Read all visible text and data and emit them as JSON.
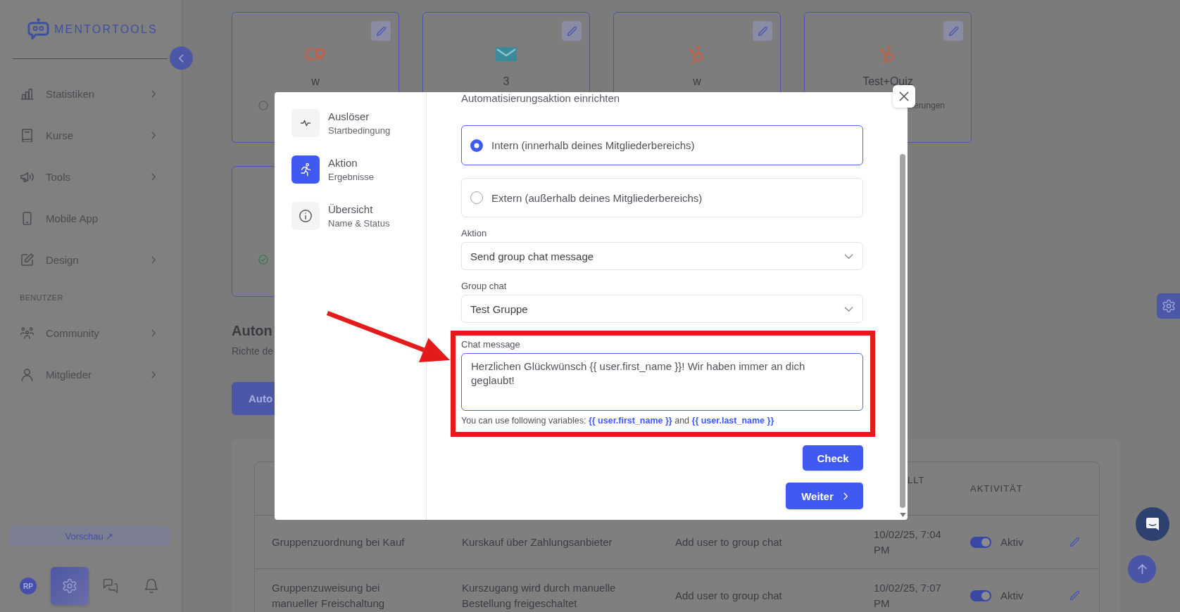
{
  "sidebar": {
    "logo": "MENTORTOOLS",
    "nav": [
      {
        "label": "Statistiken",
        "expandable": true
      },
      {
        "label": "Kurse",
        "expandable": true
      },
      {
        "label": "Tools",
        "expandable": true
      },
      {
        "label": "Mobile App",
        "expandable": false
      },
      {
        "label": "Design",
        "expandable": true
      }
    ],
    "users_section": {
      "heading": "BENUTZER",
      "nav": [
        {
          "label": "Community",
          "expandable": true
        },
        {
          "label": "Mitglieder",
          "expandable": true
        }
      ]
    },
    "preview_button": "Vorschau ↗",
    "footer": {
      "avatar": "RP",
      "buttons": [
        {
          "selected": true
        },
        {
          "selected": false
        },
        {
          "selected": false
        }
      ]
    }
  },
  "main": {
    "cards": [
      {
        "title": "w",
        "active": false
      },
      {
        "title": "3"
      },
      {
        "title": "w"
      },
      {
        "title": "Test+Quiz",
        "note": "ierungen"
      },
      {
        "active": true
      }
    ],
    "heading": "Auton",
    "subheading": "Richte de",
    "create_button": "Auto",
    "table": {
      "header": {
        "column_4": "LLT",
        "column_5": "AKTIVITÄT"
      },
      "rows": [
        {
          "column_1": "Gruppenzuordnung bei Kauf",
          "column_2": "Kurskauf über Zahlungsanbieter",
          "column_3": "Add user to group chat",
          "column_4": "10/02/25, 7:04 PM",
          "active": true,
          "activity": "Aktiv"
        },
        {
          "column_1": "Gruppenzuweisung bei manueller Freischaltung",
          "column_2": "Kurszugang wird durch manuelle Bestellung freigeschaltet",
          "column_3": "Add user to group chat",
          "column_4": "10/02/25, 7:07 PM",
          "active": true,
          "activity": "Aktiv"
        }
      ]
    }
  },
  "modal": {
    "steps": [
      {
        "title": "Auslöser",
        "subtitle": "Startbedingung",
        "selected": false
      },
      {
        "title": "Aktion",
        "subtitle": "Ergebnisse",
        "selected": true
      },
      {
        "title": "Übersicht",
        "subtitle": "Name & Status",
        "selected": false
      }
    ],
    "section_title": "Automatisierungsaktion einrichten",
    "options": [
      {
        "label": "Intern (innerhalb deines Mitgliederbereichs)",
        "selected": true
      },
      {
        "label": "Extern (außerhalb deines Mitgliederbereichs)",
        "selected": false
      }
    ],
    "fields": [
      {
        "label": "Aktion",
        "value": "Send group chat message"
      },
      {
        "label": "Group chat",
        "value": "Test Gruppe"
      }
    ],
    "message": {
      "label": "Chat message",
      "value": "Herzlichen Glückwünsch {{ user.first_name }}! Wir haben immer an dich geglaubt!",
      "help": "You can use following variables: **{{ user.first_name }}** and **{{ user.last_name }}**",
      "highlighted": true
    },
    "check_button": "Check",
    "next_button": "Weiter"
  }
}
